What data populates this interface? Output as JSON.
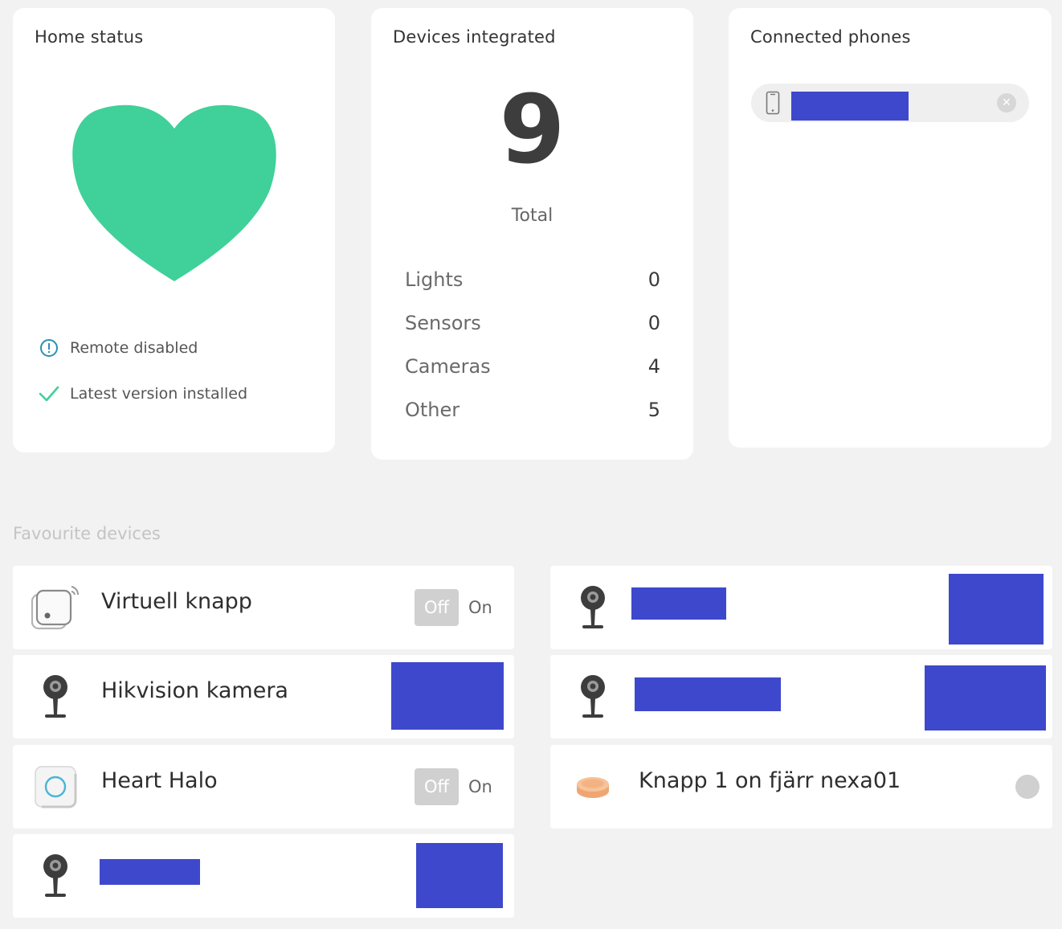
{
  "home": {
    "title": "Home status",
    "heart_color": "#40d09a",
    "status": [
      {
        "icon": "info-circle-icon",
        "text": "Remote disabled"
      },
      {
        "icon": "check-icon",
        "text": "Latest version installed"
      }
    ]
  },
  "devices": {
    "title": "Devices integrated",
    "total": "9",
    "total_label": "Total",
    "rows": [
      {
        "label": "Lights",
        "value": "0"
      },
      {
        "label": "Sensors",
        "value": "0"
      },
      {
        "label": "Cameras",
        "value": "4"
      },
      {
        "label": "Other",
        "value": "5"
      }
    ]
  },
  "phones": {
    "title": "Connected phones",
    "remove_symbol": "✕"
  },
  "favourites": {
    "title": "Favourite devices",
    "items": [
      {
        "name": "Virtuell knapp",
        "icon": "virtual-button-icon",
        "off": "Off",
        "on": "On"
      },
      {
        "name": "Hikvision kamera",
        "icon": "camera-icon"
      },
      {
        "name": "Heart Halo",
        "icon": "halo-icon",
        "off": "Off",
        "on": "On"
      },
      {
        "name": "",
        "icon": "camera-icon"
      },
      {
        "name": "",
        "icon": "camera-icon"
      },
      {
        "name": "",
        "icon": "camera-icon"
      },
      {
        "name": "Knapp 1 on fjärr nexa01",
        "icon": "remote-button-icon"
      }
    ]
  },
  "colors": {
    "redaction": "#3e48cc",
    "accent_green": "#40d09a",
    "info_blue": "#2a8fb8"
  }
}
